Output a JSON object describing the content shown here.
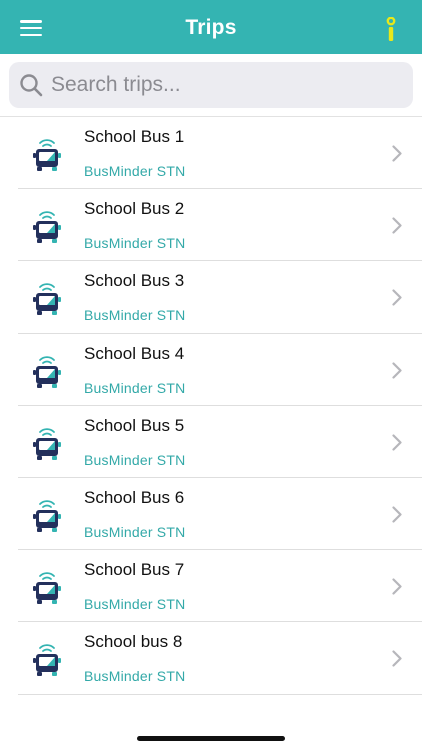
{
  "header": {
    "title": "Trips",
    "menu_icon": "hamburger-menu-icon",
    "info_icon": "info-icon",
    "background": "#34b4b2",
    "info_color": "#e8e81a"
  },
  "search": {
    "placeholder": "Search trips...",
    "value": "",
    "icon": "search-icon"
  },
  "trips": [
    {
      "name": "School Bus 1",
      "operator": "BusMinder STN"
    },
    {
      "name": "School Bus 2",
      "operator": "BusMinder STN"
    },
    {
      "name": "School Bus 3",
      "operator": "BusMinder STN"
    },
    {
      "name": "School Bus 4",
      "operator": "BusMinder STN"
    },
    {
      "name": "School Bus 5",
      "operator": "BusMinder STN"
    },
    {
      "name": "School Bus 6",
      "operator": "BusMinder STN"
    },
    {
      "name": "School Bus 7",
      "operator": "BusMinder STN"
    },
    {
      "name": "School bus 8",
      "operator": "BusMinder STN"
    }
  ],
  "colors": {
    "accent": "#34b4b2",
    "bus_dark": "#23305c",
    "bus_teal": "#34b4b2"
  }
}
